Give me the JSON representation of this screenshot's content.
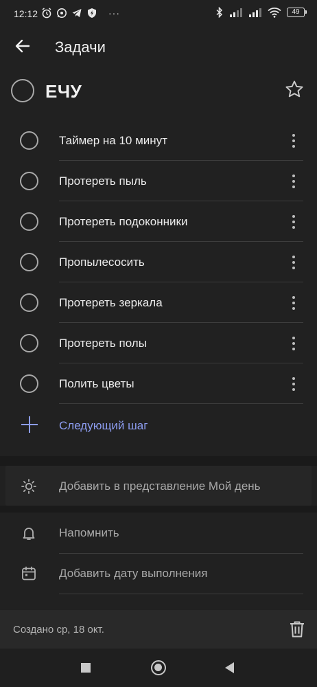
{
  "status_bar": {
    "time": "12:12",
    "battery": "49",
    "more": "···"
  },
  "header": {
    "title": "Задачи"
  },
  "task": {
    "title": "ЕЧУ",
    "important": false
  },
  "steps": [
    {
      "label": "Таймер на 10 минут"
    },
    {
      "label": "Протереть пыль"
    },
    {
      "label": "Протереть подоконники"
    },
    {
      "label": "Пропылесосить"
    },
    {
      "label": "Протереть зеркала"
    },
    {
      "label": "Протереть полы"
    },
    {
      "label": "Полить цветы"
    }
  ],
  "next_step": {
    "label": "Следующий шаг",
    "color": "#8d9df1"
  },
  "options": {
    "my_day": "Добавить в представление Мой день",
    "remind": "Напомнить",
    "due_date": "Добавить дату выполнения"
  },
  "footer": {
    "created": "Создано ср, 18 окт."
  },
  "icons": {
    "back": "arrow-left-icon",
    "star": "star-outline-icon",
    "sun": "sun-icon",
    "bell": "bell-icon",
    "calendar": "calendar-icon",
    "trash": "trash-icon"
  }
}
